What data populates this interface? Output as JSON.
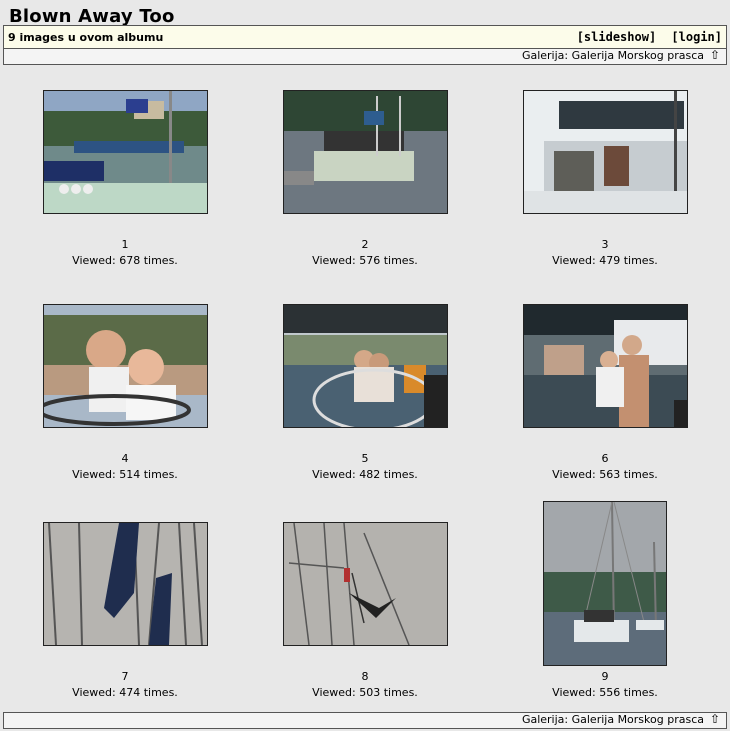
{
  "album": {
    "title": "Blown Away Too",
    "image_count_text": "9 images u ovom albumu",
    "links": {
      "slideshow": "[slideshow]",
      "login": "[login]"
    },
    "breadcrumb": "Galerija: Galerija Morskog prasca",
    "up_icon": "up-arrow-icon"
  },
  "images": [
    {
      "number": "1",
      "views": "Viewed: 678 times."
    },
    {
      "number": "2",
      "views": "Viewed: 576 times."
    },
    {
      "number": "3",
      "views": "Viewed: 479 times."
    },
    {
      "number": "4",
      "views": "Viewed: 514 times."
    },
    {
      "number": "5",
      "views": "Viewed: 482 times."
    },
    {
      "number": "6",
      "views": "Viewed: 563 times."
    },
    {
      "number": "7",
      "views": "Viewed: 474 times."
    },
    {
      "number": "8",
      "views": "Viewed: 503 times."
    },
    {
      "number": "9",
      "views": "Viewed: 556 times."
    }
  ]
}
